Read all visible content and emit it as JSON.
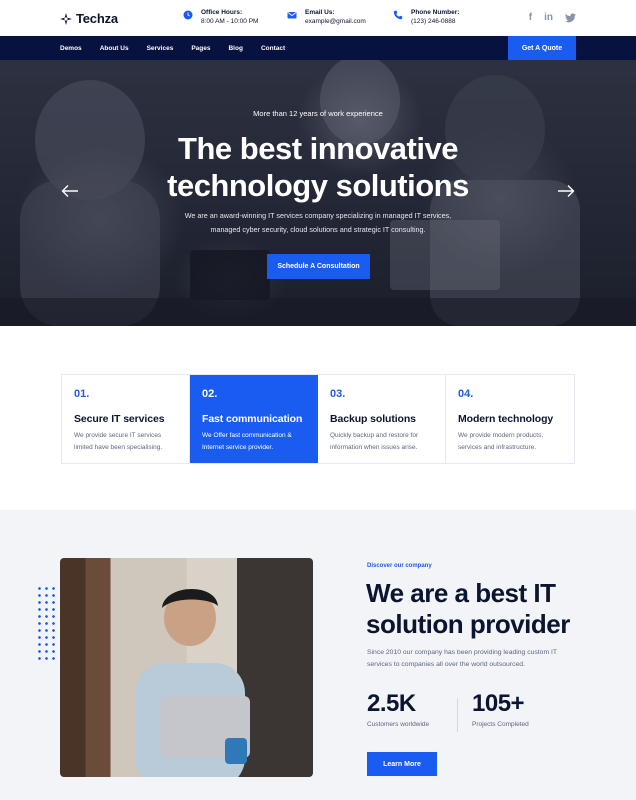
{
  "brand": {
    "name": "Techza"
  },
  "topbar": {
    "office": {
      "label": "Office Hours:",
      "value": "8:00 AM - 10:00 PM"
    },
    "email": {
      "label": "Email Us:",
      "value": "example@gmail.com"
    },
    "phone": {
      "label": "Phone Number:",
      "value": "(123) 246-0888"
    },
    "social": [
      "f",
      "in",
      "twitter"
    ]
  },
  "nav": {
    "items": [
      "Demos",
      "About Us",
      "Services",
      "Pages",
      "Blog",
      "Contact"
    ],
    "cta": "Get A Quote"
  },
  "hero": {
    "subtitle": "More than 12 years of work experience",
    "title_line1": "The best innovative",
    "title_line2": "technology solutions",
    "desc_line1": "We are an award-winning IT services company specializing in managed IT services,",
    "desc_line2": "managed cyber security, cloud solutions and strategic IT consulting.",
    "button": "Schedule A Consultation"
  },
  "features": [
    {
      "num": "01.",
      "title": "Secure IT services",
      "desc_line1": "We provide secure IT services",
      "desc_line2": "limited have been specialising."
    },
    {
      "num": "02.",
      "title": "Fast communication",
      "desc_line1": "We Offer fast communication &",
      "desc_line2": "Internet service provider."
    },
    {
      "num": "03.",
      "title": "Backup solutions",
      "desc_line1": "Quickly backup and restore for",
      "desc_line2": "information when issues arise."
    },
    {
      "num": "04.",
      "title": "Modern technology",
      "desc_line1": "We provide modern products,",
      "desc_line2": "services and infrastructure."
    }
  ],
  "about": {
    "kicker": "Discover our company",
    "title_line1": "We are a best IT",
    "title_line2": "solution provider",
    "desc": "Since 2010 our company has been providing leading custom IT services to companies all over the world outsourced.",
    "stats": [
      {
        "value": "2.5K",
        "label": "Customers worldwide"
      },
      {
        "value": "105+",
        "label": "Projects Completed"
      }
    ],
    "button": "Learn More"
  },
  "colors": {
    "accent": "#1b5cf0",
    "navy": "#071240",
    "text": "#0b1530"
  }
}
